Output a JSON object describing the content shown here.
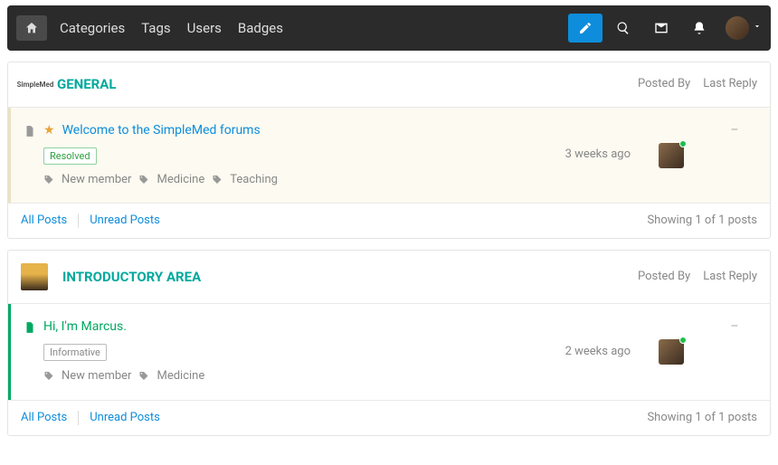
{
  "nav": {
    "categories": "Categories",
    "tags": "Tags",
    "users": "Users",
    "badges": "Badges"
  },
  "sections": [
    {
      "id": "general",
      "logo_text": "SimpleMed",
      "title": "GENERAL",
      "head": {
        "posted_by": "Posted By",
        "last_reply": "Last Reply"
      },
      "posts": [
        {
          "pinned": true,
          "title": "Welcome to the SimpleMed forums",
          "badge": {
            "label": "Resolved",
            "style": "green"
          },
          "tags": [
            "New member",
            "Medicine",
            "Teaching"
          ],
          "time": "3 weeks ago",
          "reply": "–"
        }
      ],
      "foot": {
        "all": "All Posts",
        "unread": "Unread Posts",
        "count": "Showing 1 of 1 posts"
      }
    },
    {
      "id": "introductory",
      "title": "INTRODUCTORY AREA",
      "head": {
        "posted_by": "Posted By",
        "last_reply": "Last Reply"
      },
      "posts": [
        {
          "unread": true,
          "title": "Hi, I'm Marcus.",
          "badge": {
            "label": "Informative",
            "style": "gray"
          },
          "tags": [
            "New member",
            "Medicine"
          ],
          "time": "2 weeks ago",
          "reply": "–"
        }
      ],
      "foot": {
        "all": "All Posts",
        "unread": "Unread Posts",
        "count": "Showing 1 of 1 posts"
      }
    }
  ]
}
